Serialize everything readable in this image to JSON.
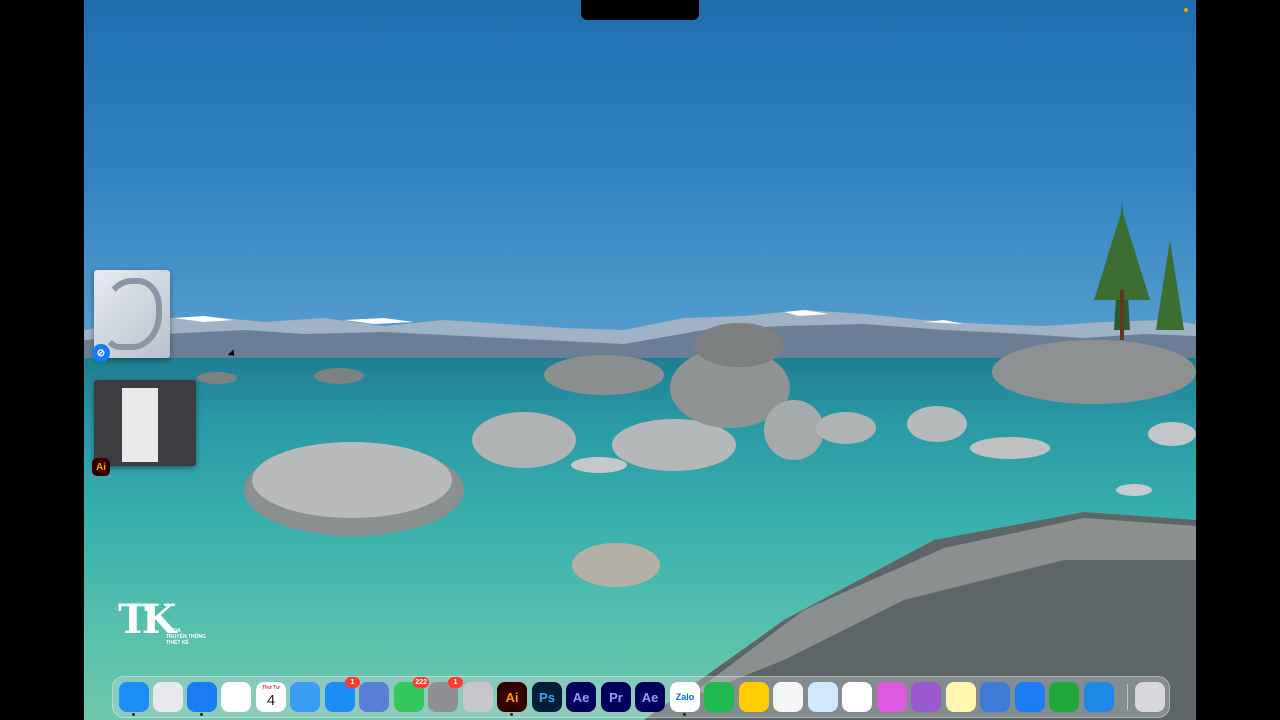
{
  "desktop": {
    "wallpaper": "lake-with-boulders"
  },
  "stage_manager": {
    "apps": [
      {
        "name": "Safari",
        "icon": "safari-icon"
      },
      {
        "name": "Ai",
        "icon": "illustrator-icon"
      }
    ]
  },
  "logo": {
    "mark": "TK",
    "tagline": "KHOA\nTRUYỀN THÔNG\nTHIẾT KẾ"
  },
  "dock": {
    "items": [
      {
        "id": "finder",
        "label": "",
        "icon": "finder-icon",
        "color": "#1e8ef7",
        "running": true
      },
      {
        "id": "launchpad",
        "label": "",
        "icon": "launchpad-icon",
        "color": "#e8e8ec",
        "running": false
      },
      {
        "id": "safari",
        "label": "",
        "icon": "safari-icon",
        "color": "#1a7cf5",
        "running": true
      },
      {
        "id": "photos",
        "label": "",
        "icon": "photos-icon",
        "color": "#ffffff",
        "running": false
      },
      {
        "id": "calendar",
        "label": "4",
        "day": "Thứ Tư",
        "icon": "calendar-icon",
        "color": "#ffffff",
        "running": false
      },
      {
        "id": "mail",
        "label": "",
        "icon": "mail-icon",
        "color": "#3a9df6",
        "running": false
      },
      {
        "id": "appstore",
        "label": "",
        "icon": "app-store-icon",
        "color": "#1c8df5",
        "badge": "1",
        "running": false
      },
      {
        "id": "simulator",
        "label": "",
        "icon": "simulator-icon",
        "color": "#5a7fd8",
        "running": false
      },
      {
        "id": "messages",
        "label": "",
        "icon": "messages-icon",
        "color": "#34c759",
        "badge": "222",
        "running": false
      },
      {
        "id": "settings",
        "label": "",
        "icon": "settings-icon",
        "color": "#8e8e93",
        "badge": "1",
        "running": false
      },
      {
        "id": "printer",
        "label": "",
        "icon": "printer-icon",
        "color": "#c8c8cc",
        "running": false
      },
      {
        "id": "illustrator",
        "label": "Ai",
        "icon": "illustrator-icon",
        "color": "#330000",
        "text_color": "#ff9a00",
        "running": true
      },
      {
        "id": "photoshop",
        "label": "Ps",
        "icon": "photoshop-icon",
        "color": "#001e36",
        "text_color": "#31a8ff",
        "running": false
      },
      {
        "id": "aftereffects",
        "label": "Ae",
        "icon": "after-effects-icon",
        "color": "#00005b",
        "text_color": "#9999ff",
        "running": false
      },
      {
        "id": "premiere",
        "label": "Pr",
        "icon": "premiere-icon",
        "color": "#00005b",
        "text_color": "#9999ff",
        "running": false
      },
      {
        "id": "aftereffects2",
        "label": "Ae",
        "icon": "after-effects-icon",
        "color": "#00005b",
        "text_color": "#9999ff",
        "running": false
      },
      {
        "id": "zalo",
        "label": "Zalo",
        "icon": "zalo-icon",
        "color": "#ffffff",
        "text_color": "#0068ff",
        "running": true
      },
      {
        "id": "numbers-plus",
        "label": "",
        "icon": "plus-icon",
        "color": "#1fb950",
        "running": false
      },
      {
        "id": "tips",
        "label": "",
        "icon": "lightbulb-icon",
        "color": "#ffcc00",
        "running": false
      },
      {
        "id": "vpn",
        "label": "",
        "icon": "shield-icon",
        "color": "#f5f5f5",
        "running": false
      },
      {
        "id": "bitwarden",
        "label": "",
        "icon": "brand-icon",
        "color": "#cfe8ff",
        "running": false
      },
      {
        "id": "gemini",
        "label": "",
        "icon": "sparkle-icon",
        "color": "#ffffff",
        "running": false
      },
      {
        "id": "cleaner",
        "label": "",
        "icon": "cleaner-icon",
        "color": "#e05adf",
        "running": false
      },
      {
        "id": "feedback",
        "label": "",
        "icon": "feedback-icon",
        "color": "#9b59d0",
        "running": false
      },
      {
        "id": "notes",
        "label": "",
        "icon": "notes-icon",
        "color": "#fff6b0",
        "running": false
      },
      {
        "id": "finder2",
        "label": "",
        "icon": "disk-icon",
        "color": "#3e7bd6",
        "running": false
      },
      {
        "id": "quicktime",
        "label": "",
        "icon": "quicktime-icon",
        "color": "#1d7cf2",
        "running": false
      },
      {
        "id": "numbers",
        "label": "",
        "icon": "numbers-icon",
        "color": "#1fa83a",
        "running": false
      },
      {
        "id": "keynote",
        "label": "",
        "icon": "keynote-icon",
        "color": "#1e88e5",
        "running": false
      },
      {
        "id": "trash",
        "label": "",
        "icon": "trash-icon",
        "color": "#d8d8dc",
        "running": false
      }
    ]
  }
}
